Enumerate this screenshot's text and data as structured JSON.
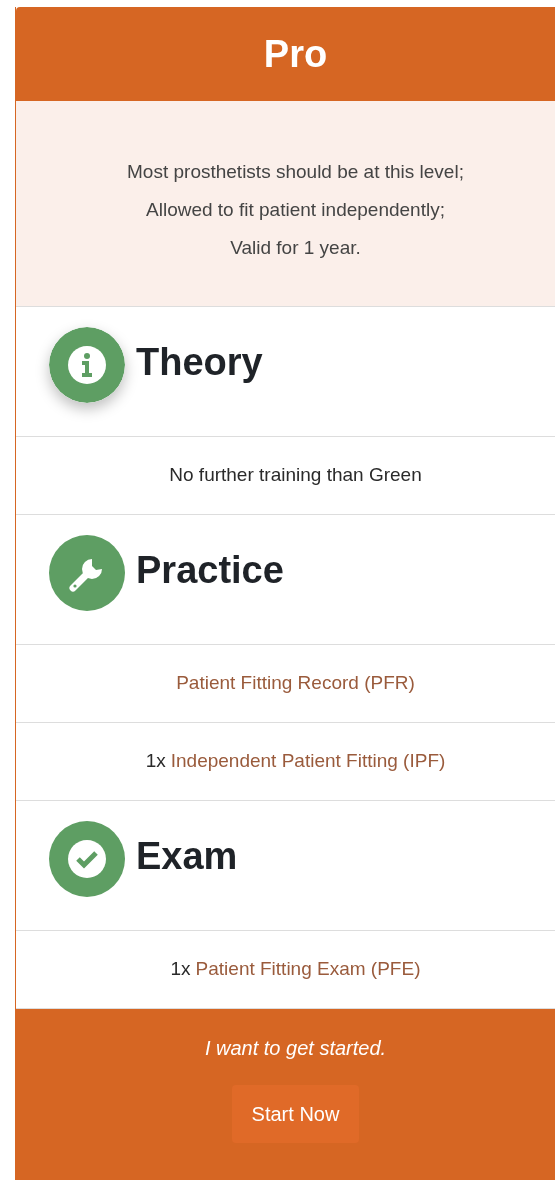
{
  "header": {
    "title": "Pro"
  },
  "description": [
    "Most prosthetists should be at this level;",
    "Allowed to fit patient independently;",
    "Valid for 1 year."
  ],
  "sections": [
    {
      "kind": "info",
      "title": "Theory",
      "items": [
        {
          "kind": "plain",
          "text": "No further training than Green"
        }
      ]
    },
    {
      "kind": "wrench",
      "title": "Practice",
      "items": [
        {
          "kind": "link",
          "text": "Patient Fitting Record (PFR)"
        },
        {
          "kind": "link",
          "prefix": "1x",
          "text": "Independent Patient Fitting (IPF)"
        }
      ]
    },
    {
      "kind": "check",
      "title": "Exam",
      "items": [
        {
          "kind": "link",
          "prefix": "1x",
          "text": "Patient Fitting Exam (PFE)"
        }
      ]
    }
  ],
  "footer": {
    "tagline": "I want to get started.",
    "button": "Start Now"
  }
}
